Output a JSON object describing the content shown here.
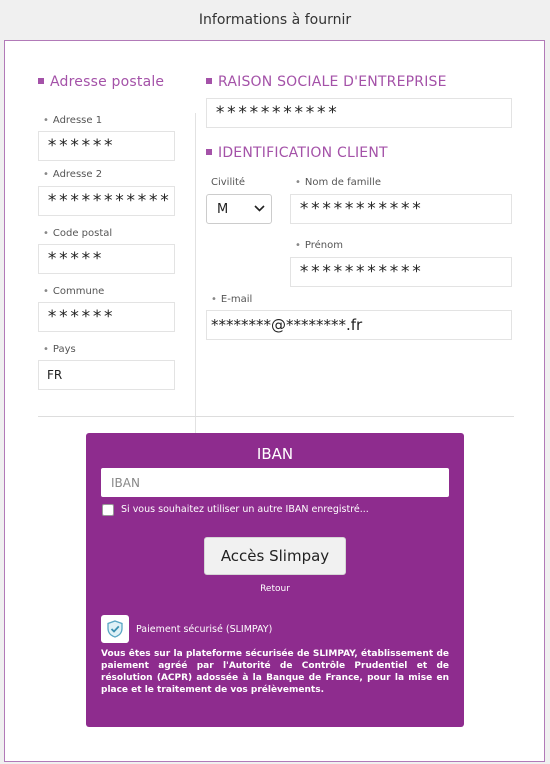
{
  "header": {
    "title": "Informations à fournir"
  },
  "address": {
    "title": "Adresse postale",
    "fields": [
      {
        "label": "Adresse 1",
        "value": "******"
      },
      {
        "label": "Adresse 2",
        "value": "***********"
      },
      {
        "label": "Code postal",
        "value": "*****"
      },
      {
        "label": "Commune",
        "value": "******"
      },
      {
        "label": "Pays",
        "value": "FR"
      }
    ]
  },
  "company": {
    "title": "RAISON SOCIALE D'ENTREPRISE",
    "value": "***********"
  },
  "client": {
    "title": "IDENTIFICATION CLIENT",
    "civility": {
      "label": "Civilité",
      "selected": "M"
    },
    "lastname": {
      "label": "Nom de famille",
      "value": "***********"
    },
    "firstname": {
      "label": "Prénom",
      "value": "***********"
    },
    "email": {
      "label": "E-mail",
      "value": "********@********.fr"
    }
  },
  "iban": {
    "title": "IBAN",
    "placeholder": "IBAN",
    "checkbox_label": "Si vous souhaitez utiliser un autre IBAN enregistré...",
    "button_label": "Accès Slimpay",
    "back_label": "Retour",
    "secure_label": "Paiement sécurisé (SLIMPAY)",
    "legal_text": "Vous êtes sur la plateforme sécurisée de SLIMPAY, établissement de paiement agréé par l'Autorité de Contrôle Prudentiel et de résolution (ACPR) adossée à la Banque de France, pour la mise en place et le traitement de vos prélèvements."
  },
  "colors": {
    "accent": "#a452a8",
    "iban_bg": "#8e2c8e"
  },
  "icons": {
    "secure": "shield-check-icon",
    "select": "chevron-down-icon"
  }
}
